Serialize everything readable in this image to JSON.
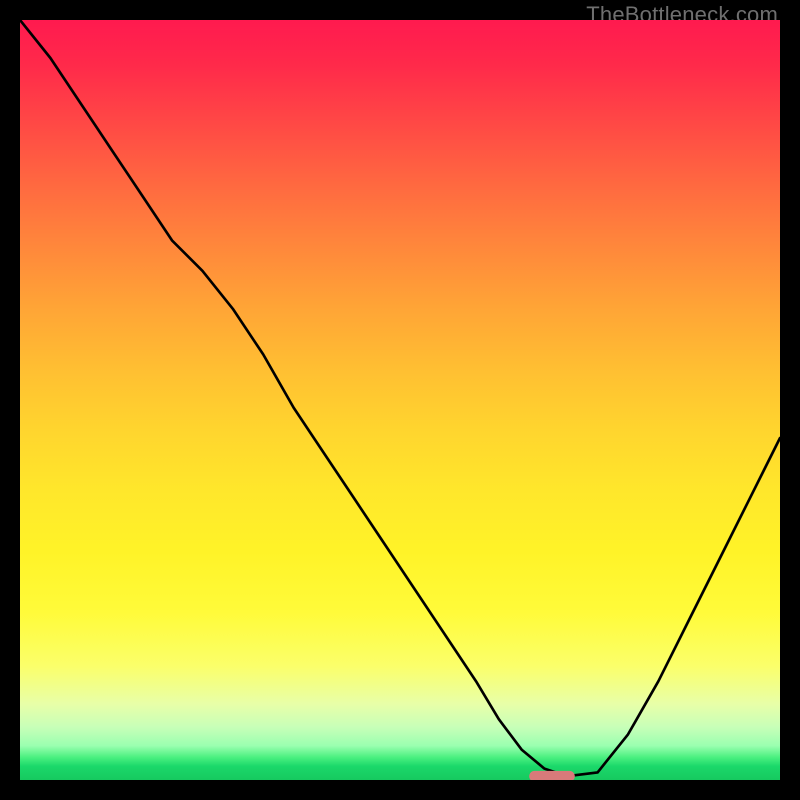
{
  "watermark": "TheBottleneck.com",
  "chart_data": {
    "type": "line",
    "title": "",
    "xlabel": "",
    "ylabel": "",
    "xlim": [
      0,
      100
    ],
    "ylim": [
      0,
      100
    ],
    "x": [
      0,
      4,
      8,
      12,
      16,
      20,
      24,
      28,
      32,
      36,
      40,
      44,
      48,
      52,
      56,
      60,
      63,
      66,
      69,
      72,
      76,
      80,
      84,
      88,
      92,
      96,
      100
    ],
    "y": [
      100,
      95,
      89,
      83,
      77,
      71,
      67,
      62,
      56,
      49,
      43,
      37,
      31,
      25,
      19,
      13,
      8,
      4,
      1.5,
      0.5,
      1,
      6,
      13,
      21,
      29,
      37,
      45
    ],
    "marker": {
      "x_range": [
        67,
        73
      ],
      "y": 0.5,
      "color": "#d87a7a"
    },
    "background_gradient": {
      "top": "#ff1a4f",
      "mid": "#ffd52e",
      "bottom": "#16c95f"
    }
  }
}
